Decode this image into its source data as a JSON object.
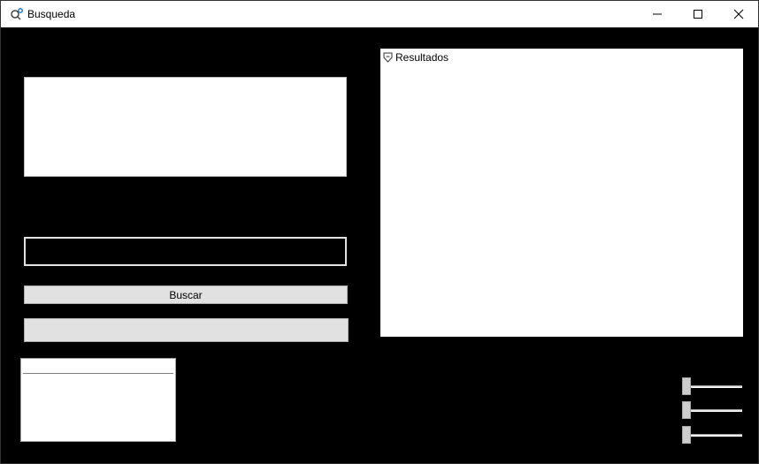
{
  "window": {
    "title": "Busqueda",
    "icon": "search-gear-icon",
    "controls": {
      "minimize_icon": "minimize-icon",
      "maximize_icon": "maximize-icon",
      "close_icon": "close-icon"
    }
  },
  "main": {
    "search_input": {
      "value": "",
      "placeholder": ""
    },
    "search_button_label": "Buscar",
    "secondary_button_label": ""
  },
  "results": {
    "label": "Resultados",
    "icon": "results-icon"
  },
  "sliders": [
    {
      "value": 0
    },
    {
      "value": 0
    },
    {
      "value": 0
    }
  ],
  "colors": {
    "background": "#000000",
    "button_face": "#e1e1e1",
    "panel": "#ffffff"
  }
}
